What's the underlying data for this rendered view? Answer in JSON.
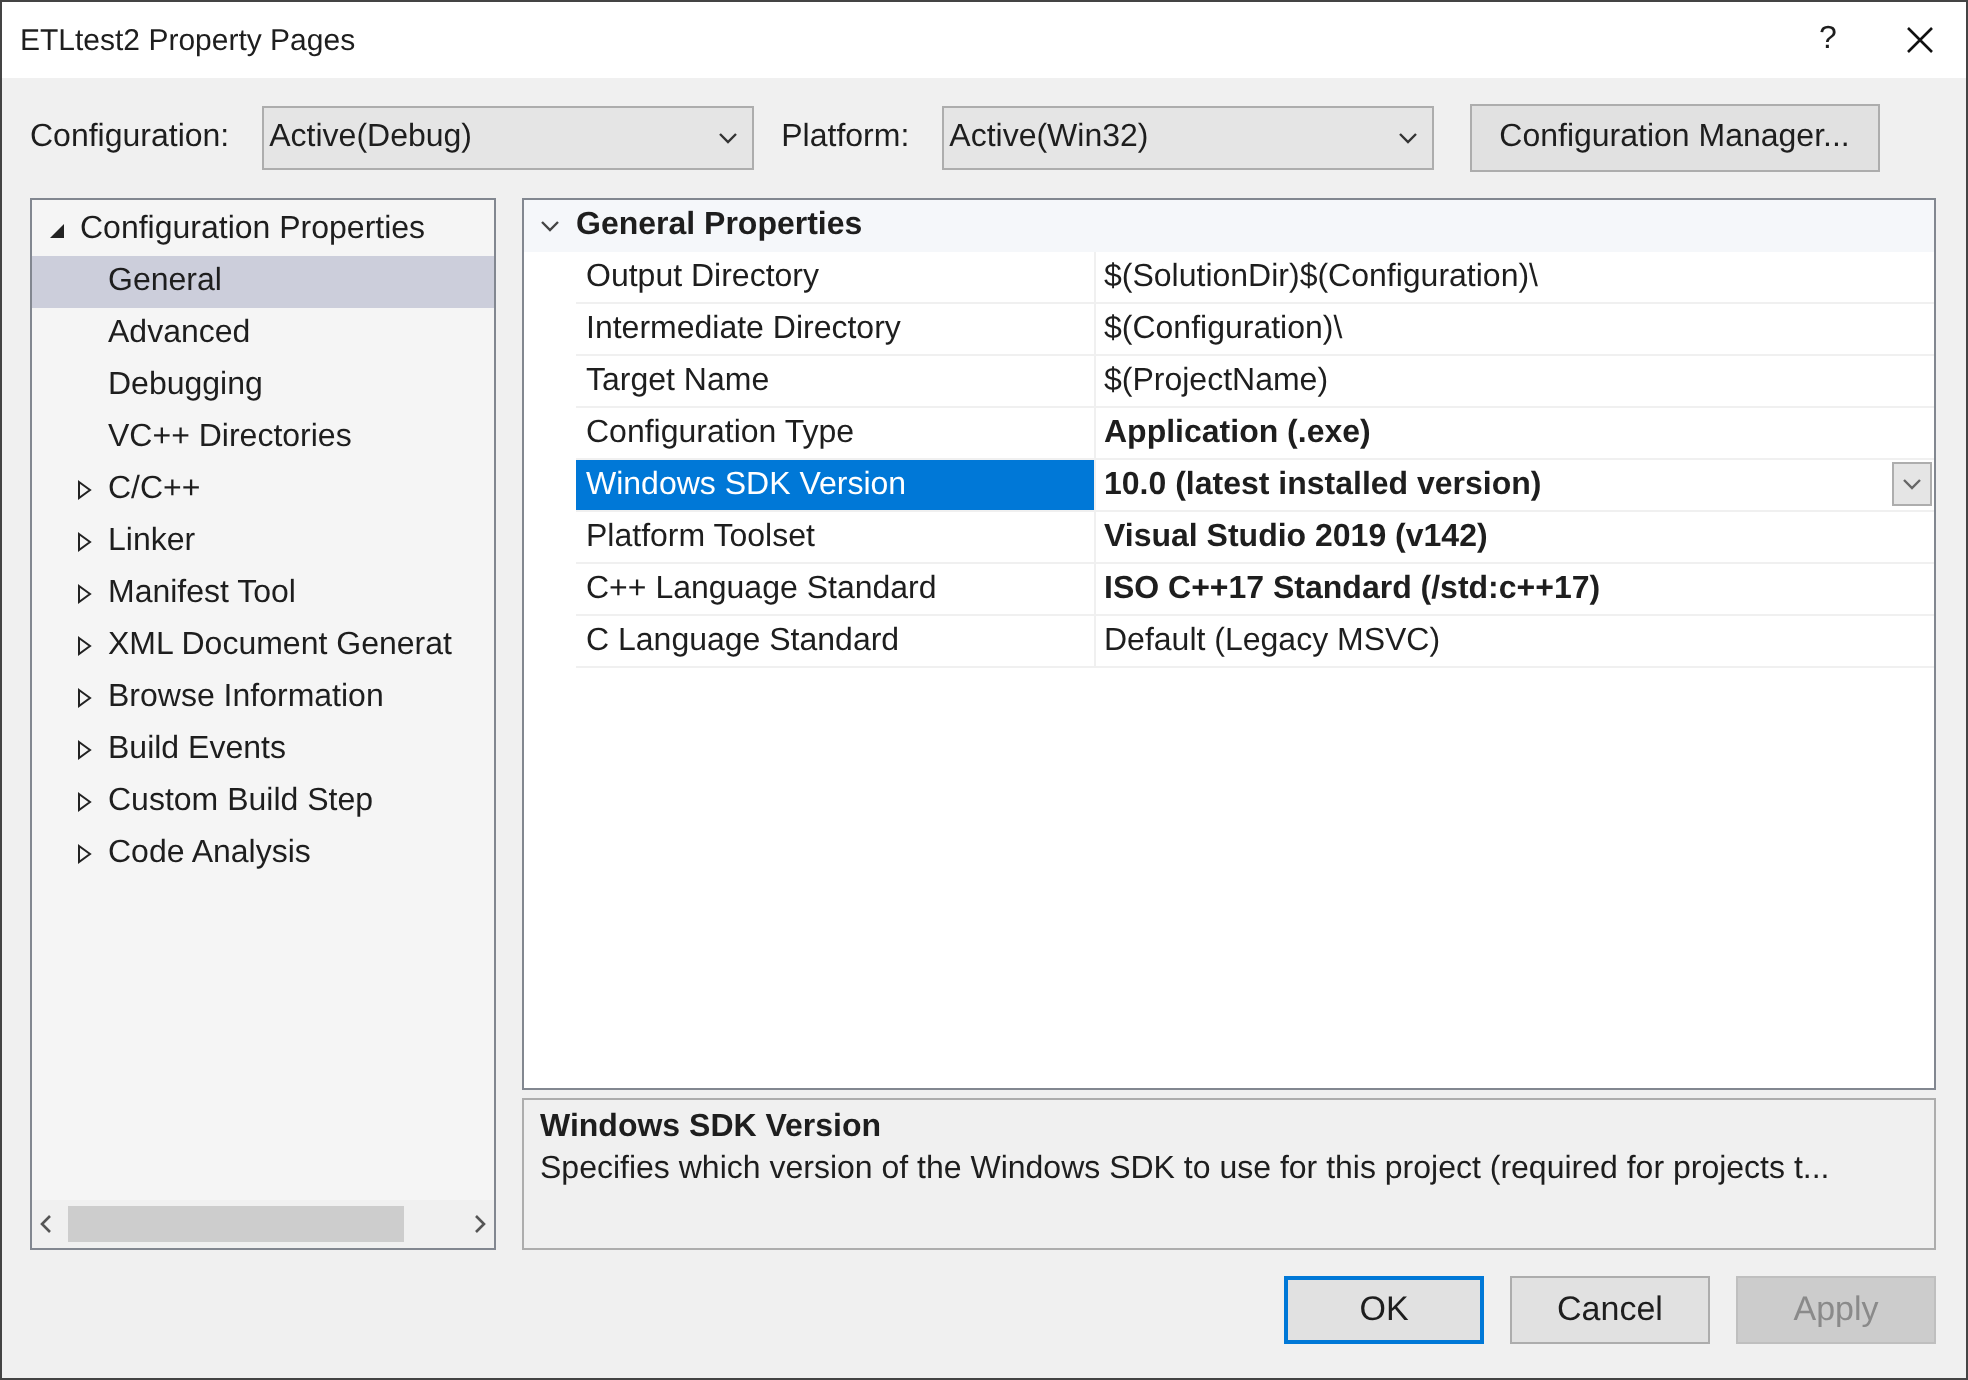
{
  "window": {
    "title": "ETLtest2 Property Pages",
    "help": "?"
  },
  "config_bar": {
    "configuration_label": "Configuration:",
    "configuration_value": "Active(Debug)",
    "platform_label": "Platform:",
    "platform_value": "Active(Win32)",
    "manager_button": "Configuration Manager..."
  },
  "tree": {
    "items": [
      {
        "label": "Configuration Properties",
        "expanded": true,
        "selected": false,
        "children": [
          {
            "label": "General",
            "selected": true
          },
          {
            "label": "Advanced",
            "selected": false
          },
          {
            "label": "Debugging",
            "selected": false
          },
          {
            "label": "VC++ Directories",
            "selected": false
          },
          {
            "label": "C/C++",
            "selected": false,
            "expanded": false
          },
          {
            "label": "Linker",
            "selected": false,
            "expanded": false
          },
          {
            "label": "Manifest Tool",
            "selected": false,
            "expanded": false
          },
          {
            "label": "XML Document Generat",
            "selected": false,
            "expanded": false
          },
          {
            "label": "Browse Information",
            "selected": false,
            "expanded": false
          },
          {
            "label": "Build Events",
            "selected": false,
            "expanded": false
          },
          {
            "label": "Custom Build Step",
            "selected": false,
            "expanded": false
          },
          {
            "label": "Code Analysis",
            "selected": false,
            "expanded": false
          }
        ]
      }
    ]
  },
  "grid": {
    "category": {
      "label": "General Properties",
      "expanded": true
    },
    "rows": [
      {
        "name": "Output Directory",
        "value": "$(SolutionDir)$(Configuration)\\",
        "modified": false,
        "selected": false
      },
      {
        "name": "Intermediate Directory",
        "value": "$(Configuration)\\",
        "modified": false,
        "selected": false
      },
      {
        "name": "Target Name",
        "value": "$(ProjectName)",
        "modified": false,
        "selected": false
      },
      {
        "name": "Configuration Type",
        "value": "Application (.exe)",
        "modified": true,
        "selected": false
      },
      {
        "name": "Windows SDK Version",
        "value": "10.0 (latest installed version)",
        "modified": true,
        "selected": true
      },
      {
        "name": "Platform Toolset",
        "value": "Visual Studio 2019 (v142)",
        "modified": true,
        "selected": false
      },
      {
        "name": "C++ Language Standard",
        "value": "ISO C++17 Standard (/std:c++17)",
        "modified": true,
        "selected": false
      },
      {
        "name": "C Language Standard",
        "value": "Default (Legacy MSVC)",
        "modified": false,
        "selected": false
      }
    ]
  },
  "description": {
    "title": "Windows SDK Version",
    "text": "Specifies which version of the Windows SDK to use for this project (required for projects t..."
  },
  "buttons": [
    {
      "label": "OK",
      "default": true,
      "disabled": false
    },
    {
      "label": "Cancel",
      "default": false,
      "disabled": false
    },
    {
      "label": "Apply",
      "default": false,
      "disabled": true
    }
  ]
}
